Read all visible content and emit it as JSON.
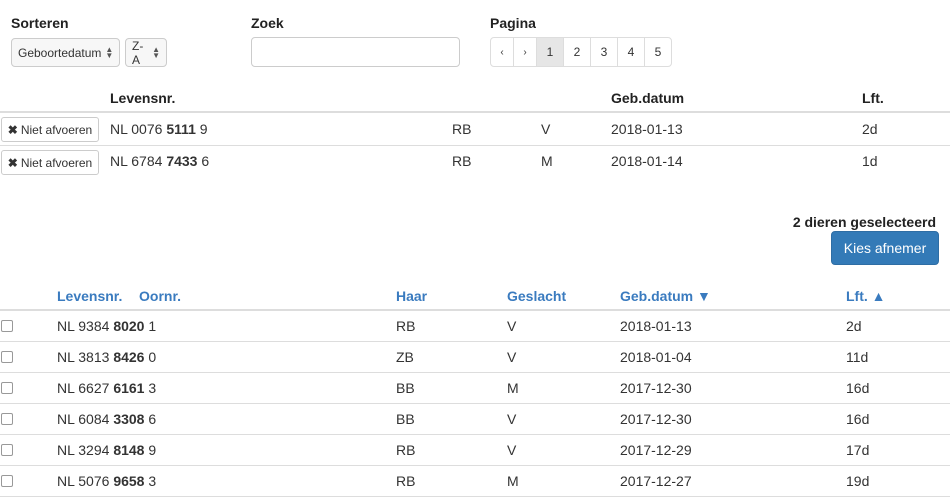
{
  "controls": {
    "sort_label": "Sorteren",
    "sort_field": "Geboortedatum",
    "sort_order": "Z-A",
    "search_label": "Zoek",
    "search_value": "",
    "page_label": "Pagina",
    "pages": [
      "‹",
      "›",
      "1",
      "2",
      "3",
      "4",
      "5"
    ],
    "active_page": "1"
  },
  "selected_table": {
    "headers": {
      "levensnr": "Levensnr.",
      "gebdatum": "Geb.datum",
      "lft": "Lft."
    },
    "remove_label": "Niet afvoeren",
    "rows": [
      {
        "prefix": "NL 0076 ",
        "bold": "5111",
        "suffix": " 9",
        "haar": "RB",
        "geslacht": "V",
        "gebdatum": "2018-01-13",
        "lft": "2d"
      },
      {
        "prefix": "NL 6784 ",
        "bold": "7433",
        "suffix": " 6",
        "haar": "RB",
        "geslacht": "M",
        "gebdatum": "2018-01-14",
        "lft": "1d"
      }
    ]
  },
  "selection": {
    "count_text": "2 dieren geselecteerd",
    "action_label": "Kies afnemer"
  },
  "animals_table": {
    "headers": {
      "levensnr": "Levensnr.",
      "oornr": "Oornr.",
      "haar": "Haar",
      "geslacht": "Geslacht",
      "gebdatum": "Geb.datum ▼",
      "lft": "Lft. ▲"
    },
    "rows": [
      {
        "prefix": "NL 9384 ",
        "bold": "8020",
        "suffix": " 1",
        "haar": "RB",
        "geslacht": "V",
        "gebdatum": "2018-01-13",
        "lft": "2d"
      },
      {
        "prefix": "NL 3813 ",
        "bold": "8426",
        "suffix": " 0",
        "haar": "ZB",
        "geslacht": "V",
        "gebdatum": "2018-01-04",
        "lft": "11d"
      },
      {
        "prefix": "NL 6627 ",
        "bold": "6161",
        "suffix": " 3",
        "haar": "BB",
        "geslacht": "M",
        "gebdatum": "2017-12-30",
        "lft": "16d"
      },
      {
        "prefix": "NL 6084 ",
        "bold": "3308",
        "suffix": " 6",
        "haar": "BB",
        "geslacht": "V",
        "gebdatum": "2017-12-30",
        "lft": "16d"
      },
      {
        "prefix": "NL 3294 ",
        "bold": "8148",
        "suffix": " 9",
        "haar": "RB",
        "geslacht": "V",
        "gebdatum": "2017-12-29",
        "lft": "17d"
      },
      {
        "prefix": "NL 5076 ",
        "bold": "9658",
        "suffix": " 3",
        "haar": "RB",
        "geslacht": "M",
        "gebdatum": "2017-12-27",
        "lft": "19d"
      }
    ]
  },
  "colors": {
    "primary": "#337ab7",
    "link": "#3a7bbf"
  }
}
